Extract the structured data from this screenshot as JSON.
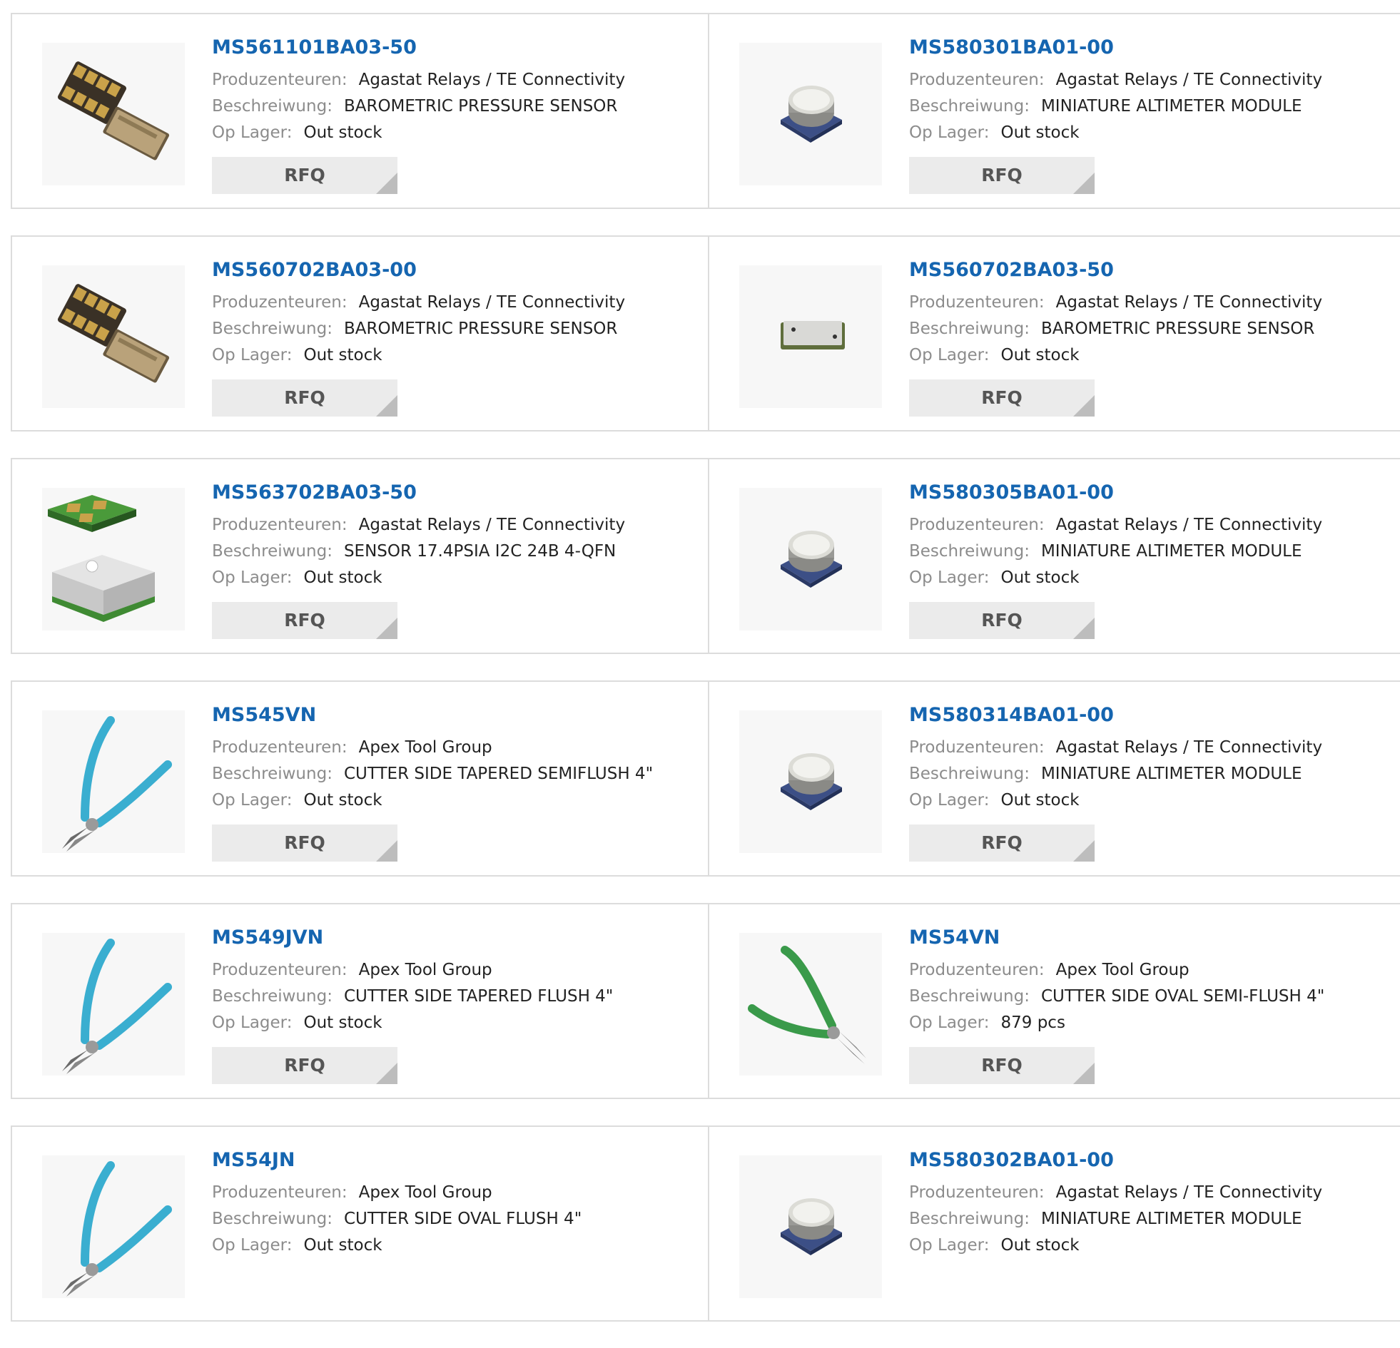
{
  "labels": {
    "manufacturer": "Produzenteuren:",
    "description": "Beschreiwung:",
    "stock": "Op Lager:",
    "rfq": "RFQ"
  },
  "products": [
    {
      "part": "MS561101BA03-50",
      "manufacturer": "Agastat Relays / TE Connectivity",
      "description": "BAROMETRIC PRESSURE SENSOR",
      "stock": "Out stock",
      "image": "sensor-chip-pair"
    },
    {
      "part": "MS580301BA01-00",
      "manufacturer": "Agastat Relays / TE Connectivity",
      "description": "MINIATURE ALTIMETER MODULE",
      "stock": "Out stock",
      "image": "altimeter-module"
    },
    {
      "part": "MS560702BA03-00",
      "manufacturer": "Agastat Relays / TE Connectivity",
      "description": "BAROMETRIC PRESSURE SENSOR",
      "stock": "Out stock",
      "image": "sensor-chip-pair"
    },
    {
      "part": "MS560702BA03-50",
      "manufacturer": "Agastat Relays / TE Connectivity",
      "description": "BAROMETRIC PRESSURE SENSOR",
      "stock": "Out stock",
      "image": "sensor-chip-single"
    },
    {
      "part": "MS563702BA03-50",
      "manufacturer": "Agastat Relays / TE Connectivity",
      "description": "SENSOR 17.4PSIA I2C 24B 4-QFN",
      "stock": "Out stock",
      "image": "qfn-sensor"
    },
    {
      "part": "MS580305BA01-00",
      "manufacturer": "Agastat Relays / TE Connectivity",
      "description": "MINIATURE ALTIMETER MODULE",
      "stock": "Out stock",
      "image": "altimeter-module"
    },
    {
      "part": "MS545VN",
      "manufacturer": "Apex Tool Group",
      "description": "CUTTER SIDE TAPERED SEMIFLUSH 4\"",
      "stock": "Out stock",
      "image": "cutter-teal"
    },
    {
      "part": "MS580314BA01-00",
      "manufacturer": "Agastat Relays / TE Connectivity",
      "description": "MINIATURE ALTIMETER MODULE",
      "stock": "Out stock",
      "image": "altimeter-module"
    },
    {
      "part": "MS549JVN",
      "manufacturer": "Apex Tool Group",
      "description": "CUTTER SIDE TAPERED FLUSH 4\"",
      "stock": "Out stock",
      "image": "cutter-teal"
    },
    {
      "part": "MS54VN",
      "manufacturer": "Apex Tool Group",
      "description": "CUTTER SIDE OVAL SEMI-FLUSH 4\"",
      "stock": "879 pcs",
      "image": "cutter-green"
    },
    {
      "part": "MS54JN",
      "manufacturer": "Apex Tool Group",
      "description": "CUTTER SIDE OVAL FLUSH 4\"",
      "stock": "Out stock",
      "image": "cutter-teal"
    },
    {
      "part": "MS580302BA01-00",
      "manufacturer": "Agastat Relays / TE Connectivity",
      "description": "MINIATURE ALTIMETER MODULE",
      "stock": "Out stock",
      "image": "altimeter-module"
    }
  ]
}
